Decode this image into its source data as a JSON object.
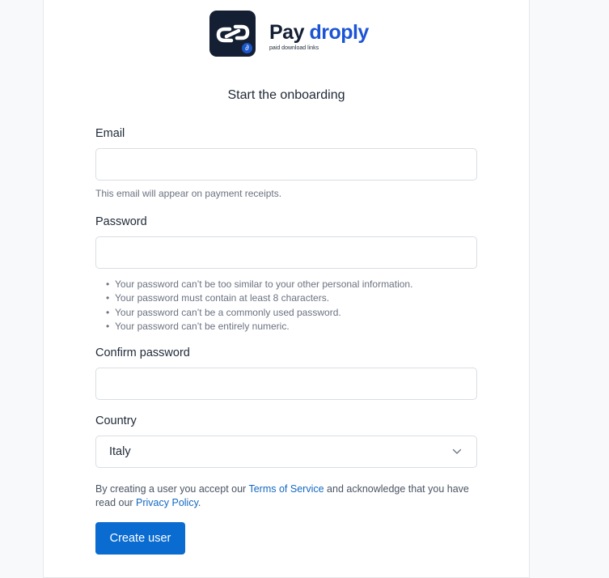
{
  "brand": {
    "name_part1": "Pay",
    "name_part2": "droply",
    "tagline": "paid download links"
  },
  "heading": "Start the onboarding",
  "form": {
    "email": {
      "label": "Email",
      "value": "",
      "help": "This email will appear on payment receipts."
    },
    "password": {
      "label": "Password",
      "value": "",
      "rules": [
        "Your password can’t be too similar to your other personal information.",
        "Your password must contain at least 8 characters.",
        "Your password can’t be a commonly used password.",
        "Your password can’t be entirely numeric."
      ]
    },
    "confirm_password": {
      "label": "Confirm password",
      "value": ""
    },
    "country": {
      "label": "Country",
      "selected": "Italy"
    }
  },
  "legal": {
    "text1": "By creating a user you accept our ",
    "terms_link": "Terms of Service",
    "text2": " and acknowledge that you have read our ",
    "privacy_link": "Privacy Policy",
    "text3": "."
  },
  "submit_label": "Create user",
  "icons": {
    "logo": "chain-link-icon",
    "select": "chevron-down-icon"
  },
  "colors": {
    "brand_dark": "#141f33",
    "brand_blue": "#1b54d4",
    "button": "#0a6bd0",
    "link": "#1468c0"
  }
}
